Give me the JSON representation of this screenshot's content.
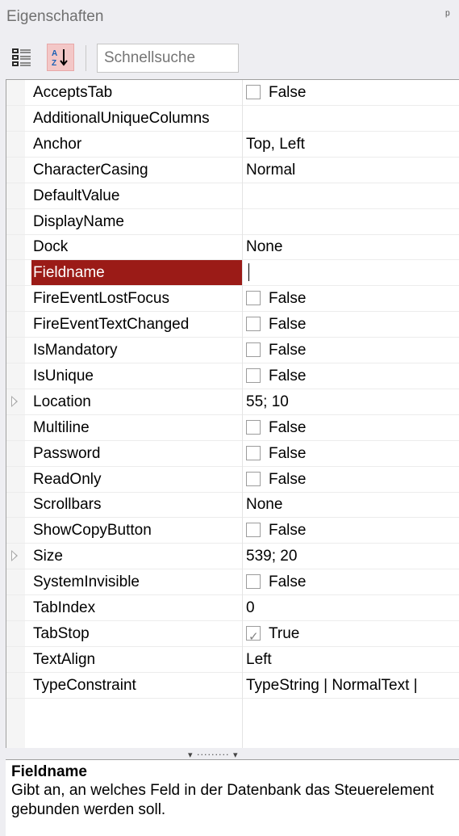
{
  "panel": {
    "title": "Eigenschaften",
    "pin_icon": "ᵖ"
  },
  "toolbar": {
    "categorized_icon": "categorized-view-icon",
    "alphabetical_icon": "sort-az-icon",
    "search_placeholder": "Schnellsuche",
    "alphabetical_active_color": "#f3c7c7"
  },
  "properties": [
    {
      "name": "AcceptsTab",
      "value": "False",
      "type": "bool",
      "checked": false
    },
    {
      "name": "AdditionalUniqueColumns",
      "value": "",
      "type": "text"
    },
    {
      "name": "Anchor",
      "value": "Top, Left",
      "type": "text"
    },
    {
      "name": "CharacterCasing",
      "value": "Normal",
      "type": "text"
    },
    {
      "name": "DefaultValue",
      "value": "",
      "type": "text"
    },
    {
      "name": "DisplayName",
      "value": "",
      "type": "text"
    },
    {
      "name": "Dock",
      "value": "None",
      "type": "text"
    },
    {
      "name": "Fieldname",
      "value": "",
      "type": "text",
      "selected": true,
      "editing": true
    },
    {
      "name": "FireEventLostFocus",
      "value": "False",
      "type": "bool",
      "checked": false
    },
    {
      "name": "FireEventTextChanged",
      "value": "False",
      "type": "bool",
      "checked": false
    },
    {
      "name": "IsMandatory",
      "value": "False",
      "type": "bool",
      "checked": false
    },
    {
      "name": "IsUnique",
      "value": "False",
      "type": "bool",
      "checked": false
    },
    {
      "name": "Location",
      "value": "55; 10",
      "type": "text",
      "expandable": true
    },
    {
      "name": "Multiline",
      "value": "False",
      "type": "bool",
      "checked": false
    },
    {
      "name": "Password",
      "value": "False",
      "type": "bool",
      "checked": false
    },
    {
      "name": "ReadOnly",
      "value": "False",
      "type": "bool",
      "checked": false
    },
    {
      "name": "Scrollbars",
      "value": "None",
      "type": "text"
    },
    {
      "name": "ShowCopyButton",
      "value": "False",
      "type": "bool",
      "checked": false
    },
    {
      "name": "Size",
      "value": "539; 20",
      "type": "text",
      "expandable": true
    },
    {
      "name": "SystemInvisible",
      "value": "False",
      "type": "bool",
      "checked": false
    },
    {
      "name": "TabIndex",
      "value": "0",
      "type": "text"
    },
    {
      "name": "TabStop",
      "value": "True",
      "type": "bool",
      "checked": true
    },
    {
      "name": "TextAlign",
      "value": "Left",
      "type": "text"
    },
    {
      "name": "TypeConstraint",
      "value": "TypeString | NormalText |",
      "type": "text"
    }
  ],
  "colors": {
    "selected_row": "#9b1b17",
    "selected_text": "#ffffff"
  },
  "help": {
    "title": "Fieldname",
    "description": "Gibt an, an welches Feld in der Datenbank das Steuerelement gebunden werden soll."
  },
  "splitter": {
    "grip": "▾ ········· ▾"
  }
}
